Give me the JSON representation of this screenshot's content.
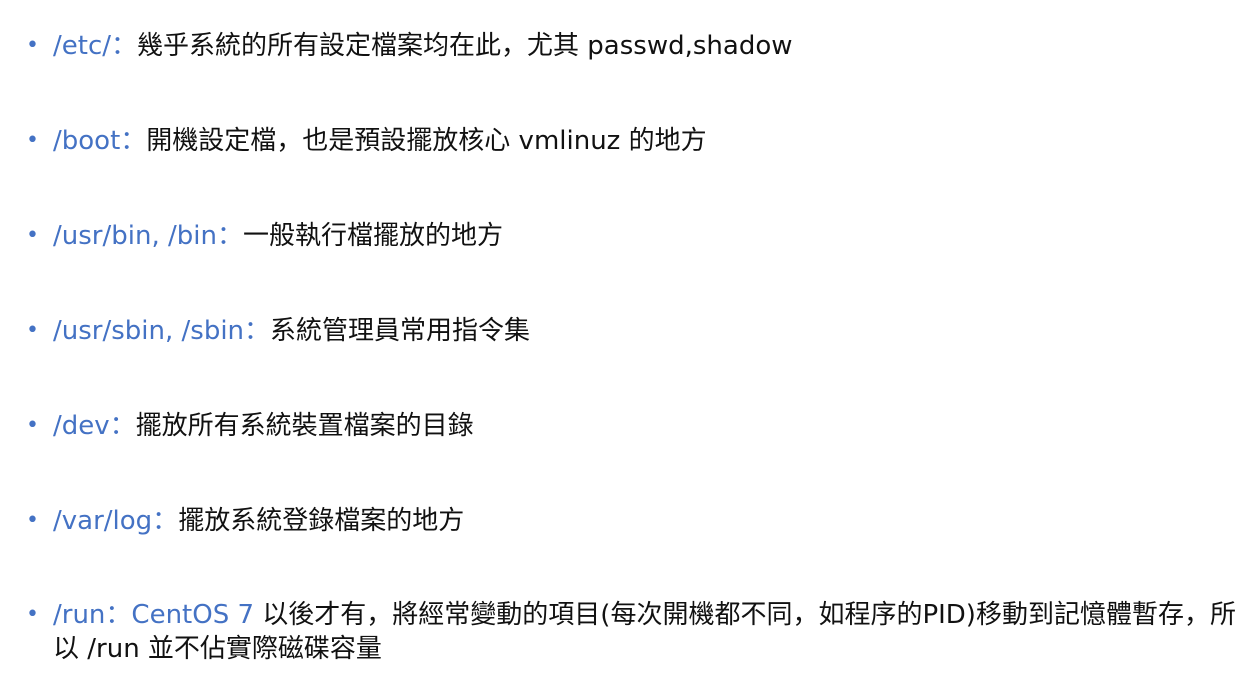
{
  "items": [
    {
      "path": "/etc/",
      "separator": "：",
      "description": "幾乎系統的所有設定檔案均在此，尤其 passwd,shadow"
    },
    {
      "path": "/boot",
      "separator": "：",
      "description": "開機設定檔，也是預設擺放核心 vmlinuz 的地方"
    },
    {
      "path": "/usr/bin, /bin",
      "separator": "：",
      "description": "一般執行檔擺放的地方"
    },
    {
      "path": "/usr/sbin, /sbin",
      "separator": "：",
      "description": "系統管理員常用指令集"
    },
    {
      "path": "/dev",
      "separator": "：",
      "description": "擺放所有系統裝置檔案的目錄"
    },
    {
      "path": "/var/log",
      "separator": "：",
      "description": "擺放系統登錄檔案的地方"
    },
    {
      "path": "/run",
      "separator": "：",
      "accent": "CentOS 7",
      "description": " 以後才有，將經常變動的項目(每次開機都不同，如程序的PID)移動到記憶體暫存，所以 /run 並不佔實際磁碟容量"
    }
  ],
  "colors": {
    "accent": "#4472c4",
    "text": "#111111"
  },
  "bullet_glyph": "•"
}
